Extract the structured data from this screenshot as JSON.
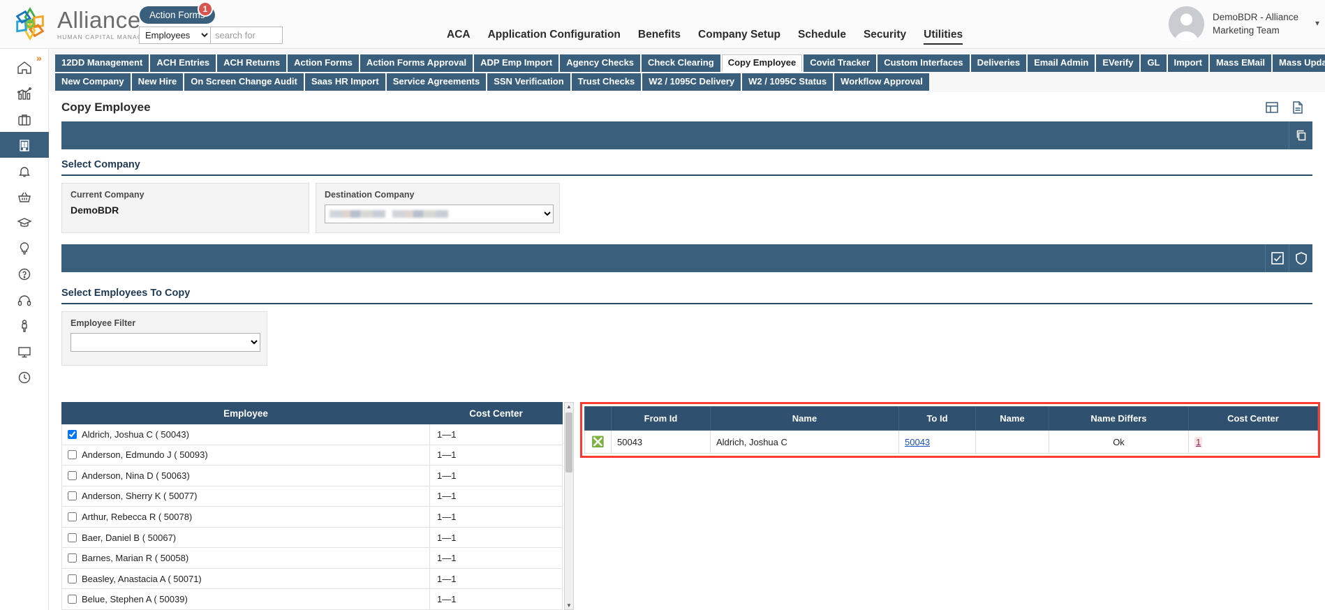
{
  "header": {
    "logo_name": "Alliance",
    "logo_sub": "HUMAN CAPITAL MANAGEMENT",
    "action_forms_label": "Action Forms",
    "action_forms_badge": "1",
    "search_scope": "Employees",
    "search_placeholder": "search for",
    "search_value": "",
    "user_line1": "DemoBDR - Alliance",
    "user_line2": "Marketing Team",
    "nav": [
      {
        "label": "ACA",
        "active": false
      },
      {
        "label": "Application Configuration",
        "active": false
      },
      {
        "label": "Benefits",
        "active": false
      },
      {
        "label": "Company Setup",
        "active": false
      },
      {
        "label": "Schedule",
        "active": false
      },
      {
        "label": "Security",
        "active": false
      },
      {
        "label": "Utilities",
        "active": true
      }
    ]
  },
  "sidebar": {
    "expand_icon": "chevron-double-right-icon",
    "items": [
      {
        "name": "home-icon",
        "active": false
      },
      {
        "name": "analytics-icon",
        "active": false
      },
      {
        "name": "briefcase-icon",
        "active": false
      },
      {
        "name": "company-building-icon",
        "active": true
      },
      {
        "name": "bell-icon",
        "active": false
      },
      {
        "name": "basket-icon",
        "active": false
      },
      {
        "name": "graduation-cap-icon",
        "active": false
      },
      {
        "name": "lightbulb-icon",
        "active": false
      },
      {
        "name": "help-circle-icon",
        "active": false
      },
      {
        "name": "headset-icon",
        "active": false
      },
      {
        "name": "person-icon",
        "active": false
      },
      {
        "name": "monitor-icon",
        "active": false
      },
      {
        "name": "clock-icon",
        "active": false
      }
    ]
  },
  "tabs_row1": [
    {
      "label": "12DD Management",
      "active": false
    },
    {
      "label": "ACH Entries",
      "active": false
    },
    {
      "label": "ACH Returns",
      "active": false
    },
    {
      "label": "Action Forms",
      "active": false
    },
    {
      "label": "Action Forms Approval",
      "active": false
    },
    {
      "label": "ADP Emp Import",
      "active": false
    },
    {
      "label": "Agency Checks",
      "active": false
    },
    {
      "label": "Check Clearing",
      "active": false
    },
    {
      "label": "Copy Employee",
      "active": true
    },
    {
      "label": "Covid Tracker",
      "active": false
    },
    {
      "label": "Custom Interfaces",
      "active": false
    },
    {
      "label": "Deliveries",
      "active": false
    },
    {
      "label": "Email Admin",
      "active": false
    },
    {
      "label": "EVerify",
      "active": false
    },
    {
      "label": "GL",
      "active": false
    },
    {
      "label": "Import",
      "active": false
    },
    {
      "label": "Mass EMail",
      "active": false
    },
    {
      "label": "Mass Update Utility",
      "active": false
    }
  ],
  "tabs_row2": [
    {
      "label": "New Company",
      "active": false
    },
    {
      "label": "New Hire",
      "active": false
    },
    {
      "label": "On Screen Change Audit",
      "active": false
    },
    {
      "label": "Saas HR Import",
      "active": false
    },
    {
      "label": "Service Agreements",
      "active": false
    },
    {
      "label": "SSN Verification",
      "active": false
    },
    {
      "label": "Trust Checks",
      "active": false
    },
    {
      "label": "W2 / 1095C Delivery",
      "active": false
    },
    {
      "label": "W2 / 1095C Status",
      "active": false
    },
    {
      "label": "Workflow Approval",
      "active": false
    }
  ],
  "page": {
    "title": "Copy Employee",
    "icon_grid": "grid-view-icon",
    "icon_doc": "document-icon",
    "icon_copy": "copy-icon",
    "icon_check": "check-icon",
    "icon_shield": "shield-icon"
  },
  "select_company": {
    "title": "Select Company",
    "current_label": "Current Company",
    "current_value": "DemoBDR",
    "destination_label": "Destination Company",
    "destination_value": ""
  },
  "select_employees": {
    "title": "Select Employees To Copy",
    "filter_label": "Employee Filter",
    "filter_value": ""
  },
  "employee_table": {
    "columns": [
      "Employee",
      "Cost Center"
    ],
    "rows": [
      {
        "checked": true,
        "name": "Aldrich, Joshua C ( 50043)",
        "cost_center": "1—1"
      },
      {
        "checked": false,
        "name": "Anderson, Edmundo J ( 50093)",
        "cost_center": "1—1"
      },
      {
        "checked": false,
        "name": "Anderson, Nina D ( 50063)",
        "cost_center": "1—1"
      },
      {
        "checked": false,
        "name": "Anderson, Sherry K ( 50077)",
        "cost_center": "1—1"
      },
      {
        "checked": false,
        "name": "Arthur, Rebecca R ( 50078)",
        "cost_center": "1—1"
      },
      {
        "checked": false,
        "name": "Baer, Daniel B ( 50067)",
        "cost_center": "1—1"
      },
      {
        "checked": false,
        "name": "Barnes, Marian R ( 50058)",
        "cost_center": "1—1"
      },
      {
        "checked": false,
        "name": "Beasley, Anastacia A ( 50071)",
        "cost_center": "1—1"
      },
      {
        "checked": false,
        "name": "Belue, Stephen A ( 50039)",
        "cost_center": "1—1"
      }
    ]
  },
  "result_table": {
    "columns": [
      "",
      "From Id",
      "Name",
      "To Id",
      "Name",
      "Name Differs",
      "Cost Center"
    ],
    "rows": [
      {
        "delete_icon": "delete-circle-icon",
        "from_id": "50043",
        "from_name": "Aldrich, Joshua C",
        "to_id": "50043",
        "to_name": "",
        "name_differs": "Ok",
        "cost_center": "1"
      }
    ]
  },
  "colors": {
    "brand_blue": "#3a5f7d",
    "table_header": "#2f506e",
    "highlight_red": "#fc3b34",
    "badge_red": "#d9534f",
    "accent_orange": "#e8821e"
  }
}
